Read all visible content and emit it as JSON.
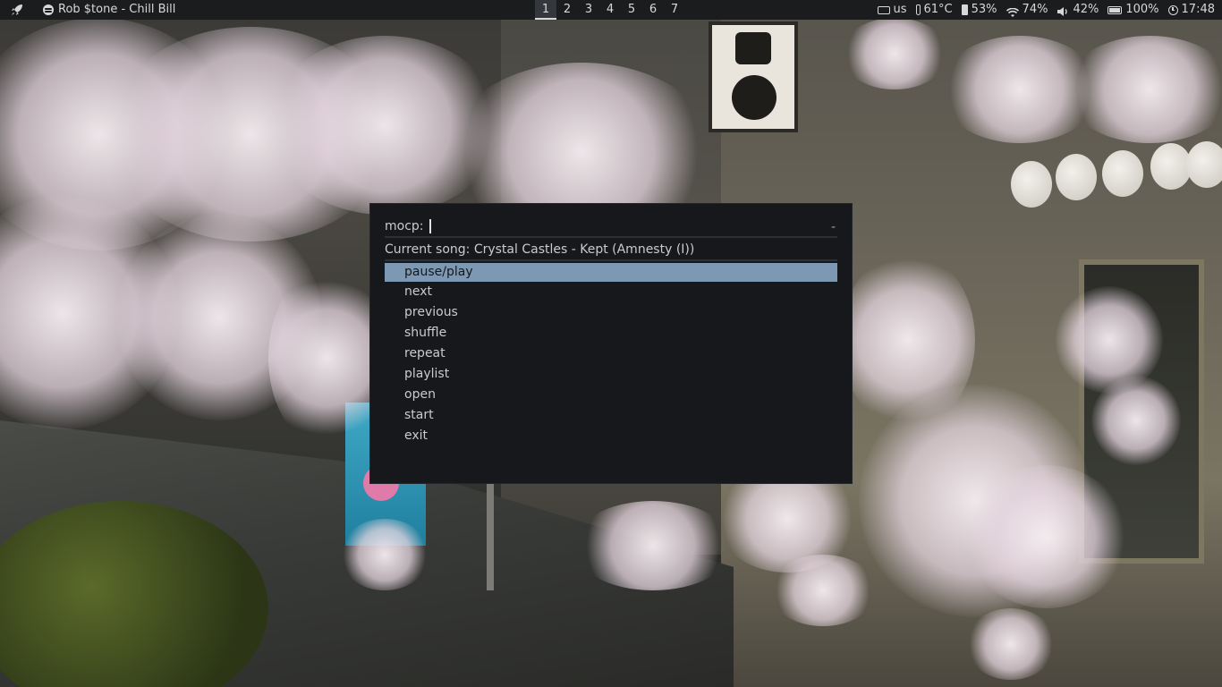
{
  "panel": {
    "launcher_icon": "rocket-icon",
    "now_playing": "Rob $tone - Chill Bill",
    "workspaces": [
      "1",
      "2",
      "3",
      "4",
      "5",
      "6",
      "7"
    ],
    "active_workspace": "1",
    "keyboard_layout": "us",
    "temperature": "61°C",
    "battery_voltage_pct": "53%",
    "wifi": "74%",
    "volume": "42%",
    "battery": "100%",
    "time": "17:48"
  },
  "menu": {
    "prompt": "mocp:",
    "input_value": "",
    "case_indicator": "-",
    "message": "Current song: Crystal Castles - Kept (Amnesty (I))",
    "items": [
      "pause/play",
      "next",
      "previous",
      "shuffle",
      "repeat",
      "playlist",
      "open",
      "start",
      "exit"
    ],
    "selected_index": 0
  },
  "colors": {
    "panel_bg": "#1a1c1e",
    "menu_bg": "#16181b",
    "selection": "#7c98b3",
    "text": "#c9cbcd"
  }
}
